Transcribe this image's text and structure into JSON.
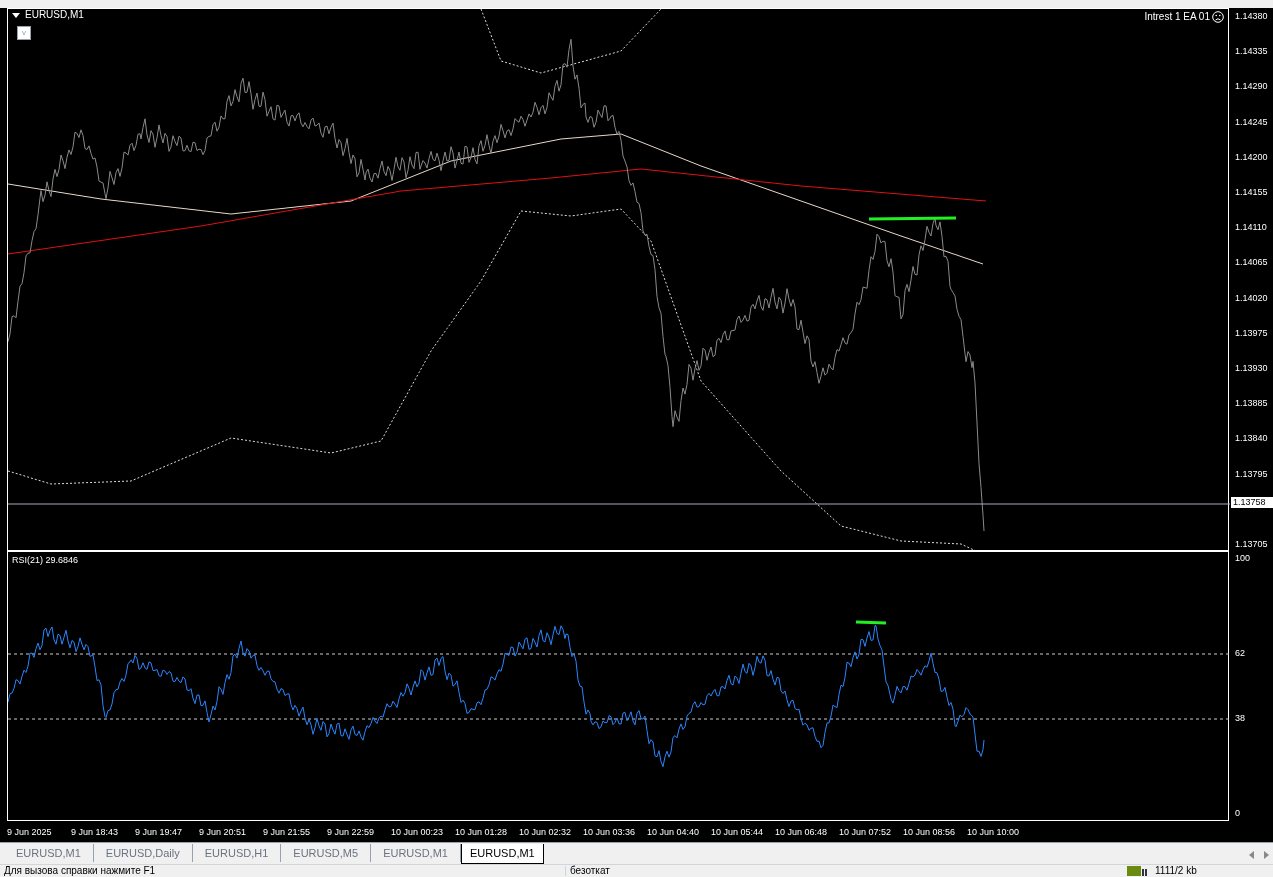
{
  "chart": {
    "title": "EURUSD,M1",
    "button": "v",
    "expert": "Intrest 1 EA 01",
    "price_ticks": [
      "1.14380",
      "1.14335",
      "1.14290",
      "1.14245",
      "1.14200",
      "1.14155",
      "1.14110",
      "1.14065",
      "1.14020",
      "1.13975",
      "1.13930",
      "1.13885",
      "1.13840",
      "1.13795",
      "1.13705"
    ],
    "current_price": "1.13758"
  },
  "indicator": {
    "title": "RSI(21) 29.6846",
    "ticks": [
      "100",
      "62",
      "38",
      "0"
    ]
  },
  "time_axis": [
    "9 Jun 2025",
    "9 Jun 18:43",
    "9 Jun 19:47",
    "9 Jun 20:51",
    "9 Jun 21:55",
    "9 Jun 22:59",
    "10 Jun 00:23",
    "10 Jun 01:28",
    "10 Jun 02:32",
    "10 Jun 03:36",
    "10 Jun 04:40",
    "10 Jun 05:44",
    "10 Jun 06:48",
    "10 Jun 07:52",
    "10 Jun 08:56",
    "10 Jun 10:00"
  ],
  "tabs": [
    {
      "label": "EURUSD,M1",
      "selected": false
    },
    {
      "label": "EURUSD,Daily",
      "selected": false
    },
    {
      "label": "EURUSD,H1",
      "selected": false
    },
    {
      "label": "EURUSD,M5",
      "selected": false
    },
    {
      "label": "EURUSD,M1",
      "selected": false
    },
    {
      "label": "EURUSD,M1",
      "selected": true
    }
  ],
  "status_bar": {
    "help": "Для вызова справки нажмите F1",
    "connection": "безоткат",
    "traffic": "1111/2 kb"
  }
}
